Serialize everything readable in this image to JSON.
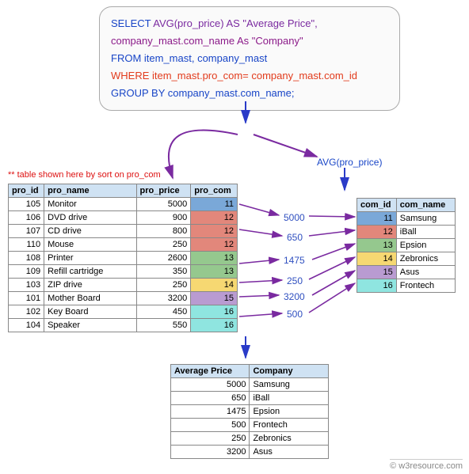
{
  "sql": {
    "line1_select": "SELECT ",
    "line1_fn": "AVG(pro_price) AS \"Average Price\",",
    "line2": "company_mast.com_name As \"Company\"",
    "line3": "FROM item_mast, company_mast",
    "line4": "WHERE item_mast.pro_com= company_mast.com_id",
    "line5": "GROUP BY company_mast.com_name;"
  },
  "note": "** table shown here  by sort on pro_com",
  "avg_label": "AVG(pro_price)",
  "item_table": {
    "headers": [
      "pro_id",
      "pro_name",
      "pro_price",
      "pro_com"
    ],
    "rows": [
      {
        "pro_id": "105",
        "pro_name": "Monitor",
        "pro_price": "5000",
        "pro_com": "11",
        "cls": "c11"
      },
      {
        "pro_id": "106",
        "pro_name": "DVD drive",
        "pro_price": "900",
        "pro_com": "12",
        "cls": "c12"
      },
      {
        "pro_id": "107",
        "pro_name": "CD drive",
        "pro_price": "800",
        "pro_com": "12",
        "cls": "c12"
      },
      {
        "pro_id": "110",
        "pro_name": "Mouse",
        "pro_price": "250",
        "pro_com": "12",
        "cls": "c12"
      },
      {
        "pro_id": "108",
        "pro_name": "Printer",
        "pro_price": "2600",
        "pro_com": "13",
        "cls": "c13"
      },
      {
        "pro_id": "109",
        "pro_name": "Refill cartridge",
        "pro_price": "350",
        "pro_com": "13",
        "cls": "c13"
      },
      {
        "pro_id": "103",
        "pro_name": "ZIP drive",
        "pro_price": "250",
        "pro_com": "14",
        "cls": "c14"
      },
      {
        "pro_id": "101",
        "pro_name": "Mother Board",
        "pro_price": "3200",
        "pro_com": "15",
        "cls": "c15"
      },
      {
        "pro_id": "102",
        "pro_name": "Key Board",
        "pro_price": "450",
        "pro_com": "16",
        "cls": "c16"
      },
      {
        "pro_id": "104",
        "pro_name": "Speaker",
        "pro_price": "550",
        "pro_com": "16",
        "cls": "c16"
      }
    ]
  },
  "company_table": {
    "headers": [
      "com_id",
      "com_name"
    ],
    "rows": [
      {
        "com_id": "11",
        "com_name": "Samsung",
        "cls": "c11"
      },
      {
        "com_id": "12",
        "com_name": "iBall",
        "cls": "c12"
      },
      {
        "com_id": "13",
        "com_name": "Epsion",
        "cls": "c13"
      },
      {
        "com_id": "14",
        "com_name": "Zebronics",
        "cls": "c14"
      },
      {
        "com_id": "15",
        "com_name": "Asus",
        "cls": "c15"
      },
      {
        "com_id": "16",
        "com_name": "Frontech",
        "cls": "c16"
      }
    ]
  },
  "avg_values": [
    "5000",
    "650",
    "1475",
    "250",
    "3200",
    "500"
  ],
  "result_table": {
    "headers": [
      "Average Price",
      "Company"
    ],
    "rows": [
      {
        "avg": "5000",
        "company": "Samsung"
      },
      {
        "avg": "650",
        "company": "iBall"
      },
      {
        "avg": "1475",
        "company": "Epsion"
      },
      {
        "avg": "500",
        "company": "Frontech"
      },
      {
        "avg": "250",
        "company": "Zebronics"
      },
      {
        "avg": "3200",
        "company": "Asus"
      }
    ]
  },
  "attribution": "© w3resource.com"
}
